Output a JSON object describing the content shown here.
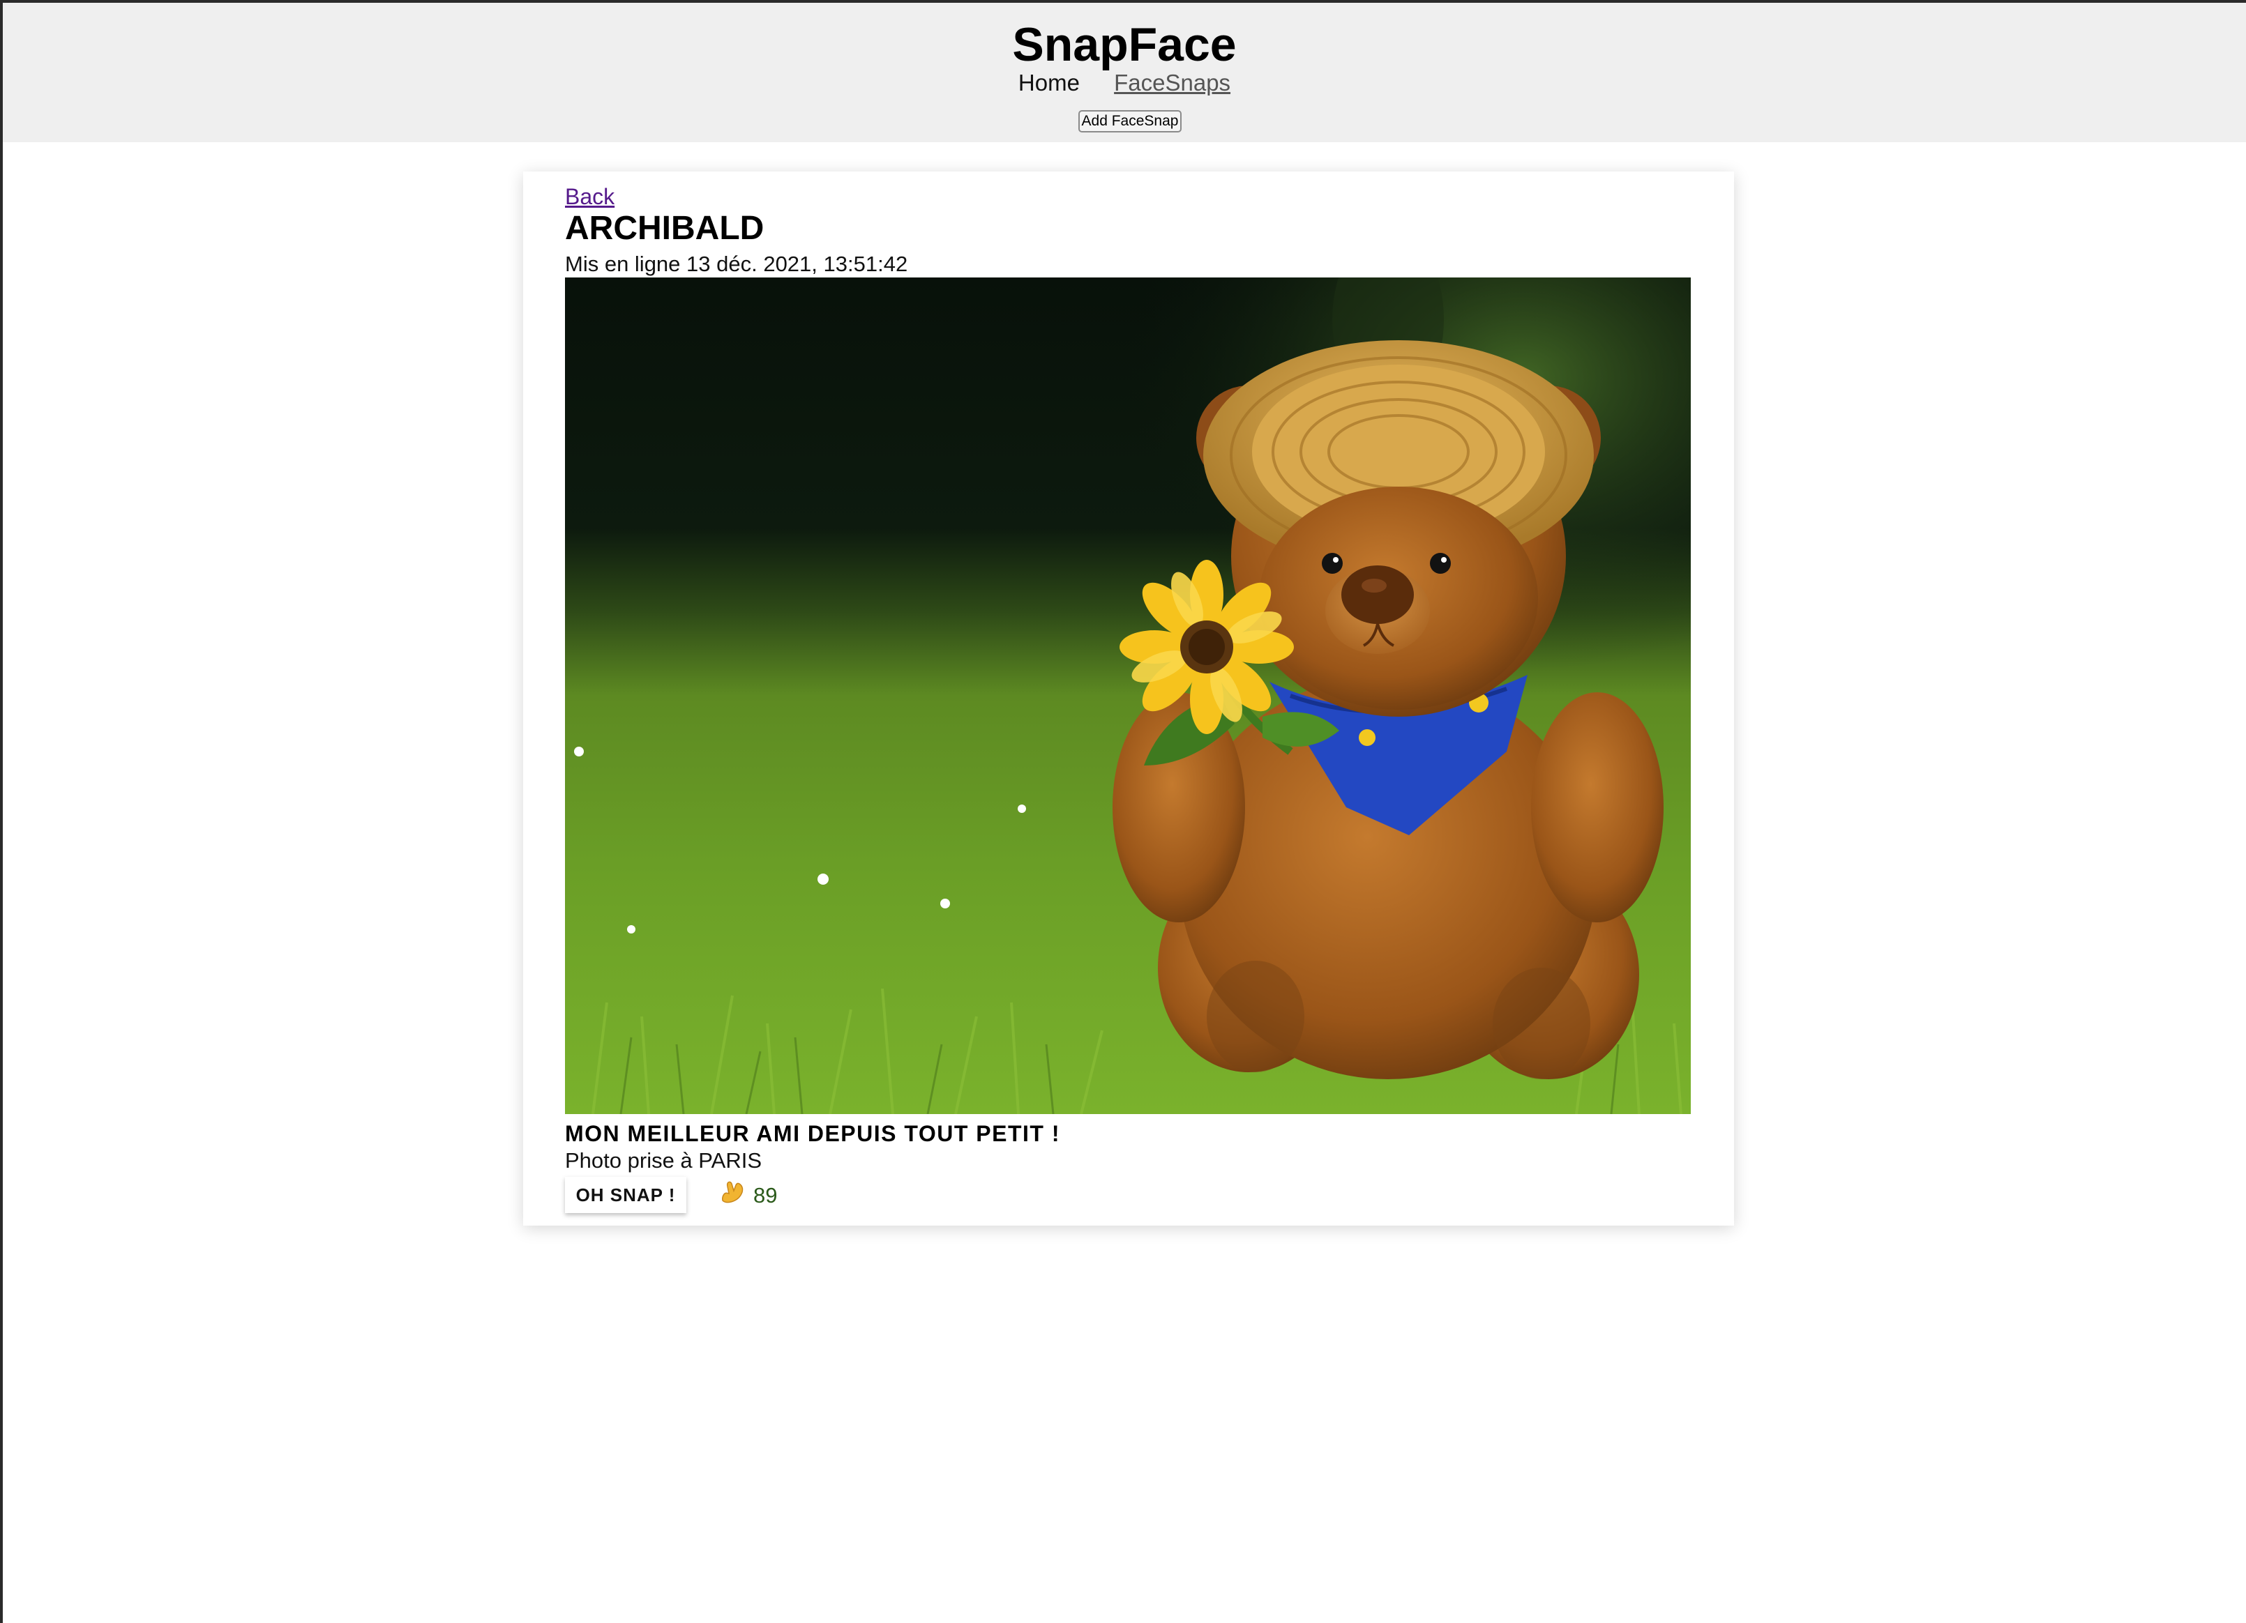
{
  "header": {
    "app_title": "SnapFace",
    "nav": [
      {
        "label": "Home",
        "active": false
      },
      {
        "label": "FaceSnaps",
        "active": true
      }
    ],
    "add_button_label": "Add FaceSnap"
  },
  "snap": {
    "back_label": "Back",
    "title": "ARCHIBALD",
    "date_text": "Mis en ligne 13 déc. 2021, 13:51:42",
    "description": "MON MEILLEUR AMI DEPUIS TOUT PETIT !",
    "location_text": "Photo prise à PARIS",
    "snap_button_label": "OH SNAP !",
    "snap_count": "89",
    "snap_icon": "snap-hand-icon",
    "photo_subject": "teddy-bear-photo"
  },
  "colors": {
    "header_bg": "#efefef",
    "link_visited": "#551a8b",
    "snap_count": "#2b5a1a"
  }
}
